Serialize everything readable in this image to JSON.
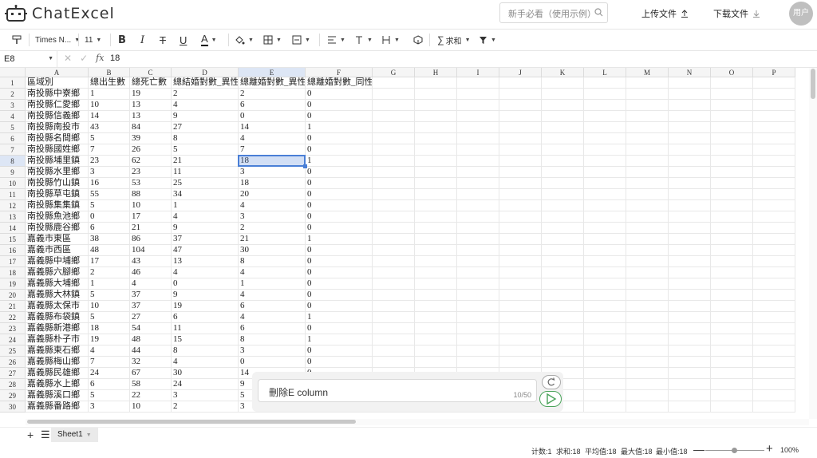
{
  "header": {
    "logo_text": "ChatExcel",
    "search_placeholder": "新手必看（使用示例）",
    "upload_label": "上传文件",
    "download_label": "下载文件",
    "user_label": "用户"
  },
  "toolbar": {
    "font_name": "Times N...",
    "font_size": "11",
    "sum_label": "求和"
  },
  "formula_bar": {
    "cell_ref": "E8",
    "fx_label": "fx",
    "value": "18"
  },
  "grid": {
    "columns": [
      "A",
      "B",
      "C",
      "D",
      "E",
      "F",
      "G",
      "H",
      "I",
      "J",
      "K",
      "L",
      "M",
      "N",
      "O",
      "P"
    ],
    "row_numbers": [
      "1",
      "2",
      "3",
      "4",
      "5",
      "6",
      "7",
      "8",
      "9",
      "10",
      "11",
      "12",
      "13",
      "14",
      "15",
      "16",
      "17",
      "18",
      "19",
      "20",
      "21",
      "22",
      "23",
      "24",
      "25",
      "26",
      "27",
      "28",
      "29",
      "30"
    ],
    "rows": [
      [
        "區域別",
        "總出生數",
        "總死亡數",
        "總結婚對數_異性",
        "總離婚對數_異性",
        "總離婚對數_同性"
      ],
      [
        "南投縣中寮鄉",
        "1",
        "19",
        "2",
        "2",
        "0"
      ],
      [
        "南投縣仁愛鄉",
        "10",
        "13",
        "4",
        "6",
        "0"
      ],
      [
        "南投縣信義鄉",
        "14",
        "13",
        "9",
        "0",
        "0"
      ],
      [
        "南投縣南投市",
        "43",
        "84",
        "27",
        "14",
        "1"
      ],
      [
        "南投縣名間鄉",
        "5",
        "39",
        "8",
        "4",
        "0"
      ],
      [
        "南投縣國姓鄉",
        "7",
        "26",
        "5",
        "7",
        "0"
      ],
      [
        "南投縣埔里鎮",
        "23",
        "62",
        "21",
        "18",
        "1"
      ],
      [
        "南投縣水里鄉",
        "3",
        "23",
        "11",
        "3",
        "0"
      ],
      [
        "南投縣竹山鎮",
        "16",
        "53",
        "25",
        "18",
        "0"
      ],
      [
        "南投縣草屯鎮",
        "55",
        "88",
        "34",
        "20",
        "0"
      ],
      [
        "南投縣集集鎮",
        "5",
        "10",
        "1",
        "4",
        "0"
      ],
      [
        "南投縣魚池鄉",
        "0",
        "17",
        "4",
        "3",
        "0"
      ],
      [
        "南投縣鹿谷鄉",
        "6",
        "21",
        "9",
        "2",
        "0"
      ],
      [
        "嘉義市東區",
        "38",
        "86",
        "37",
        "21",
        "1"
      ],
      [
        "嘉義市西區",
        "48",
        "104",
        "47",
        "30",
        "0"
      ],
      [
        "嘉義縣中埔鄉",
        "17",
        "43",
        "13",
        "8",
        "0"
      ],
      [
        "嘉義縣六腳鄉",
        "2",
        "46",
        "4",
        "4",
        "0"
      ],
      [
        "嘉義縣大埔鄉",
        "1",
        "4",
        "0",
        "1",
        "0"
      ],
      [
        "嘉義縣大林鎮",
        "5",
        "37",
        "9",
        "4",
        "0"
      ],
      [
        "嘉義縣太保市",
        "10",
        "37",
        "19",
        "6",
        "0"
      ],
      [
        "嘉義縣布袋鎮",
        "5",
        "27",
        "6",
        "4",
        "1"
      ],
      [
        "嘉義縣新港鄉",
        "18",
        "54",
        "11",
        "6",
        "0"
      ],
      [
        "嘉義縣朴子市",
        "19",
        "48",
        "15",
        "8",
        "1"
      ],
      [
        "嘉義縣東石鄉",
        "4",
        "44",
        "8",
        "3",
        "0"
      ],
      [
        "嘉義縣梅山鄉",
        "7",
        "32",
        "4",
        "0",
        "0"
      ],
      [
        "嘉義縣民雄鄉",
        "24",
        "67",
        "30",
        "14",
        "0"
      ],
      [
        "嘉義縣水上鄉",
        "6",
        "58",
        "24",
        "9",
        "0"
      ],
      [
        "嘉義縣溪口鄉",
        "5",
        "22",
        "3",
        "5",
        "0"
      ],
      [
        "嘉義縣番路鄉",
        "3",
        "10",
        "2",
        "3",
        "0"
      ]
    ]
  },
  "chat": {
    "input_text": "刪除E column",
    "char_count": "10/50"
  },
  "sheet": {
    "tab_name": "Sheet1"
  },
  "status": {
    "count": "计数:1",
    "sum": "求和:18",
    "average": "平均值:18",
    "max": "最大值:18",
    "min": "最小值:18",
    "zoom": "100%"
  }
}
